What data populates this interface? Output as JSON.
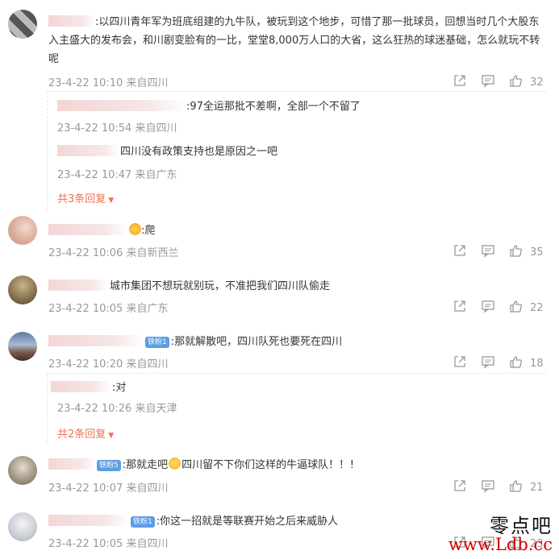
{
  "comments": [
    {
      "text": ":以四川青年军为班底组建的九牛队，被玩到这个地步，可惜了那一批球员，回想当时几个大股东入主盛大的发布会，和川剧变脸有的一比，堂堂8,000万人口的大省，这么狂热的球迷基础，怎么就玩不转呢",
      "time": "23-4-22 10:10 来自四川",
      "likes": "32",
      "replies": [
        {
          "text": ":97全运那批不差啊，全部一个不留了",
          "time": "23-4-22 10:54 来自四川"
        },
        {
          "text": "四川没有政策支持也是原因之一吧",
          "time": "23-4-22 10:47 来自广东"
        }
      ],
      "more": "共3条回复"
    },
    {
      "text": ":爬",
      "time": "23-4-22 10:06 来自新西兰",
      "likes": "35"
    },
    {
      "text": "城市集团不想玩就别玩，不准把我们四川队偷走",
      "time": "23-4-22 10:05 来自广东",
      "likes": "22"
    },
    {
      "badge": "铁粉1",
      "text": ":那就解散吧，四川队死也要死在四川",
      "time": "23-4-22 10:20 来自四川",
      "likes": "18",
      "replies": [
        {
          "text": ":对",
          "time": "23-4-22 10:26 来自天津"
        }
      ],
      "more": "共2条回复"
    },
    {
      "badge": "铁粉5",
      "text": ":那就走吧",
      "text2": "四川留不下你们这样的牛逼球队！！！",
      "time": "23-4-22 10:07 来自四川",
      "likes": "21"
    },
    {
      "badge": "铁粉1",
      "text": ":你这一招就是等联赛开始之后来威胁人",
      "time": "23-4-22 10:05 来自四川",
      "likes": "23"
    }
  ],
  "watermark": {
    "line1": "零点吧",
    "line2": "www.Ldb.cc"
  },
  "icons": [
    "share-icon",
    "comment-icon",
    "like-icon",
    "chevron-down-icon"
  ],
  "colors": {
    "more": "#eb7350",
    "meta": "#999999",
    "badge": "#5b9ee6"
  }
}
